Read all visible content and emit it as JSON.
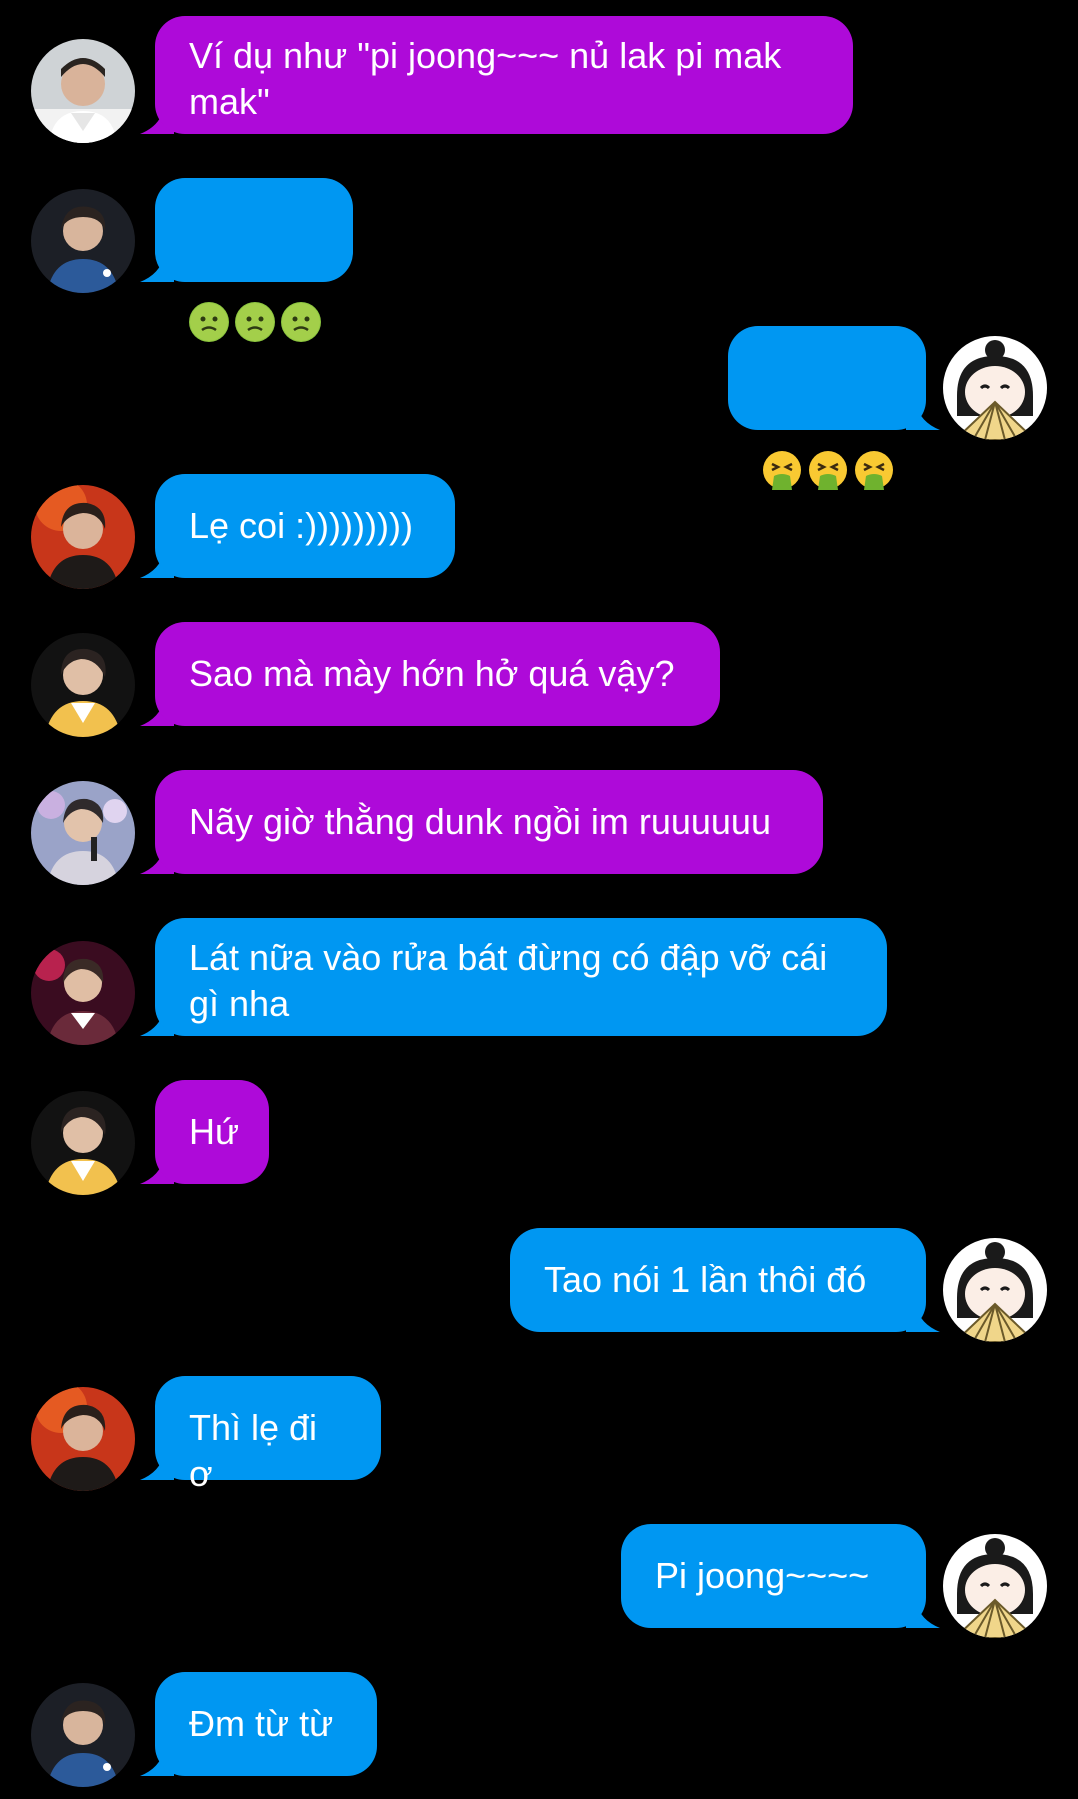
{
  "colors": {
    "background": "#000000",
    "purple": "#ae0ad9",
    "blue": "#0097f2",
    "text": "#ffffff"
  },
  "messages": [
    {
      "side": "in",
      "color": "purple",
      "avatar": "avatar-man-white-shirt",
      "text": "Ví dụ như \"pi joong~~~ nủ lak pi mak\nmak\""
    },
    {
      "side": "in",
      "color": "blue",
      "avatar": "avatar-man-blue-jacket",
      "emoji": [
        "nauseated-face-icon",
        "nauseated-face-icon",
        "nauseated-face-icon"
      ]
    },
    {
      "side": "out",
      "color": "blue",
      "avatar": "avatar-cartoon-girl-fan",
      "emoji": [
        "vomiting-face-icon",
        "vomiting-face-icon",
        "vomiting-face-icon"
      ]
    },
    {
      "side": "in",
      "color": "blue",
      "avatar": "avatar-man-red-background",
      "text": "Lẹ coi :)))))))))"
    },
    {
      "side": "in",
      "color": "purple",
      "avatar": "avatar-man-yellow-jacket",
      "text": "Sao mà mày hớn hở quá vậy?"
    },
    {
      "side": "in",
      "color": "purple",
      "avatar": "avatar-man-microphone",
      "text": "Nãy giờ thằng dunk ngồi im ruuuuuu"
    },
    {
      "side": "in",
      "color": "blue",
      "avatar": "avatar-man-maroon-jacket",
      "text": "Lát nữa vào rửa bát đừng có đập vỡ cái\ngì nha"
    },
    {
      "side": "in",
      "color": "purple",
      "avatar": "avatar-man-yellow-jacket",
      "text": "Hứ"
    },
    {
      "side": "out",
      "color": "blue",
      "avatar": "avatar-cartoon-girl-fan",
      "text": "Tao nói 1 lần thôi đó"
    },
    {
      "side": "in",
      "color": "blue",
      "avatar": "avatar-man-red-background",
      "text": "Thì lẹ đi ơ"
    },
    {
      "side": "out",
      "color": "blue",
      "avatar": "avatar-cartoon-girl-fan",
      "text": "Pi joong~~~~"
    },
    {
      "side": "in",
      "color": "blue",
      "avatar": "avatar-man-blue-jacket",
      "text": "Đm từ từ"
    }
  ]
}
